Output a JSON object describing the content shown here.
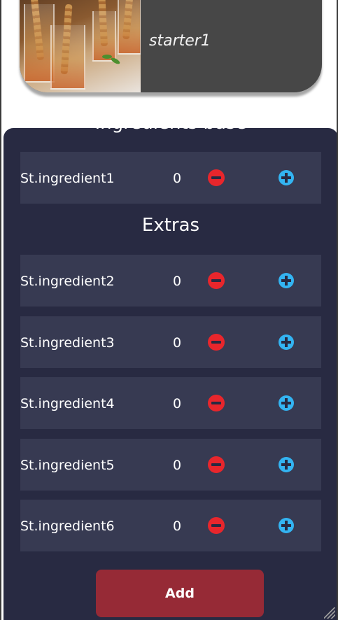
{
  "header": {
    "title": "starter1",
    "image_alt": "starter dish image"
  },
  "sections": {
    "base_title": "Ingredients base",
    "extras_title": "Extras"
  },
  "base_ingredients": [
    {
      "name": "St.ingredient1",
      "qty": "0"
    }
  ],
  "extra_ingredients": [
    {
      "name": "St.ingredient2",
      "qty": "0"
    },
    {
      "name": "St.ingredient3",
      "qty": "0"
    },
    {
      "name": "St.ingredient4",
      "qty": "0"
    },
    {
      "name": "St.ingredient5",
      "qty": "0"
    },
    {
      "name": "St.ingredient6",
      "qty": "0"
    }
  ],
  "actions": {
    "add_label": "Add"
  },
  "icons": {
    "decrement": "minus-circle-icon",
    "increment": "plus-circle-icon"
  },
  "colors": {
    "panel_bg": "#282a42",
    "row_bg": "#373a52",
    "header_bg": "#474747",
    "decrement": "#e8262c",
    "increment": "#33b4f2",
    "add_button": "#962a36"
  }
}
